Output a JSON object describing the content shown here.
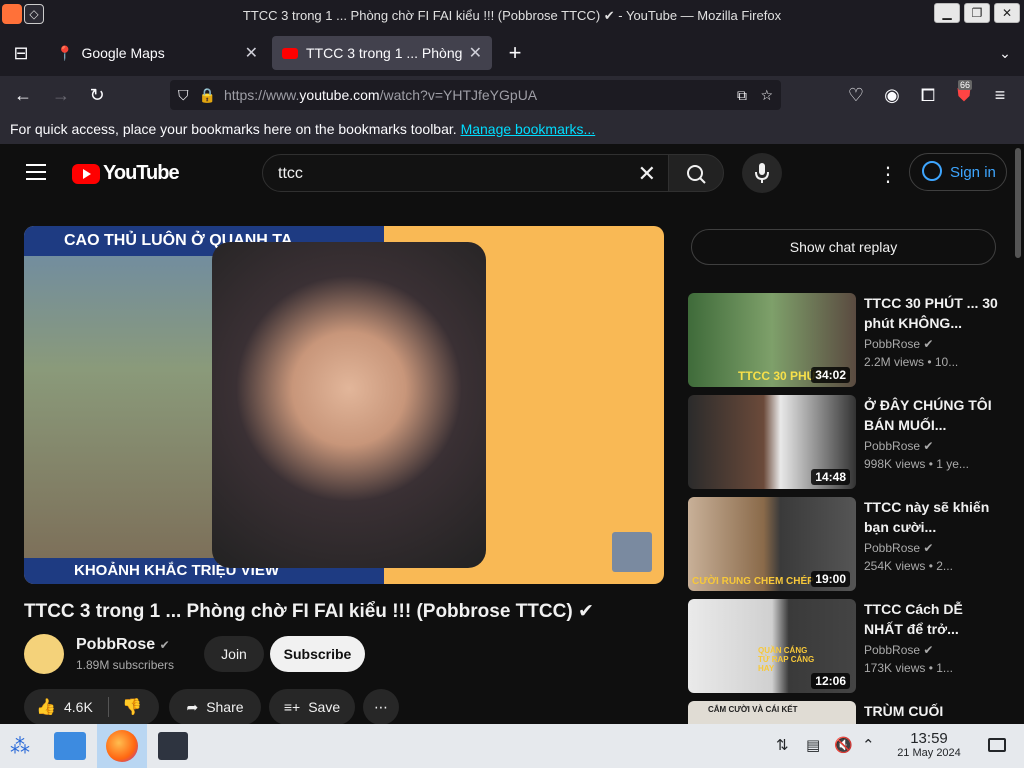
{
  "window": {
    "title": "TTCC 3 trong 1 ... Phòng chờ FI FAI kiểu !!! (Pobbrose TTCC) ✔ - YouTube — Mozilla Firefox"
  },
  "tabs": [
    {
      "label": "Google Maps"
    },
    {
      "label": "TTCC 3 trong 1 ... Phòng"
    }
  ],
  "url": {
    "prefix": "https://www.",
    "domain": "youtube.com",
    "path": "/watch?v=YHTJfeYGpUA"
  },
  "bookmarks_bar": {
    "text": "For quick access, place your bookmarks here on the bookmarks toolbar.",
    "link": "Manage bookmarks..."
  },
  "ext_badge": "66",
  "youtube": {
    "logo": "YouTube",
    "search_value": "ttcc",
    "sign_in": "Sign in",
    "video": {
      "title": "TTCC 3 trong 1 ... Phòng chờ FI FAI kiểu !!! (Pobbrose TTCC) ✔",
      "overlay_top": "CAO THỦ LUÔN Ở QUANH TA",
      "overlay_bottom": "KHOẢNH KHẮC TRIỆU VIEW"
    },
    "channel": {
      "name": "PobbRose",
      "subscribers": "1.89M subscribers",
      "join": "Join",
      "subscribe": "Subscribe"
    },
    "actions": {
      "likes": "4.6K",
      "share": "Share",
      "save": "Save"
    },
    "show_chat": "Show chat replay",
    "recommended": [
      {
        "title": "TTCC 30 PHÚT ... 30 phút KHÔNG...",
        "channel": "PobbRose",
        "meta": "2.2M views • 10...",
        "duration": "34:02",
        "thumb_text": "TTCC 30 PHÚT"
      },
      {
        "title": "Ở ĐÂY CHÚNG TÔI BÁN MUỐI...",
        "channel": "PobbRose",
        "meta": "998K views • 1 ye...",
        "duration": "14:48",
        "thumb_text": ""
      },
      {
        "title": "TTCC này sẽ khiến bạn cười...",
        "channel": "PobbRose",
        "meta": "254K views • 2...",
        "duration": "19:00",
        "thumb_text": "CƯỜI RUNG CHEM CHÉP"
      },
      {
        "title": "TTCC Cách DỄ NHẤT để trở...",
        "channel": "PobbRose",
        "meta": "173K views • 1...",
        "duration": "12:06",
        "thumb_text": "QUẦN CÁNG TỬ RAP CÁNG HAY"
      },
      {
        "title": "TRÙM CUỐI",
        "channel": "",
        "meta": "",
        "duration": "",
        "thumb_text": "CẮM CƯỜI VÀ CÁI KẾT"
      }
    ]
  },
  "taskbar": {
    "time": "13:59",
    "date": "21 May 2024"
  }
}
